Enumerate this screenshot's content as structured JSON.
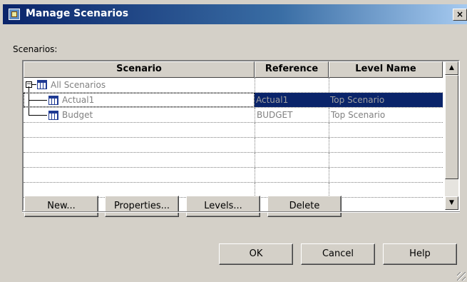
{
  "window": {
    "title": "Manage Scenarios",
    "close_label": "×"
  },
  "scenarios_label": "Scenarios:",
  "grid": {
    "columns": [
      "Scenario",
      "Reference",
      "Level Name"
    ],
    "rows": [
      {
        "name": "All Scenarios",
        "reference": "",
        "level": ""
      },
      {
        "name": "Actual1",
        "reference": "Actual1",
        "level": "Top Scenario"
      },
      {
        "name": "Budget",
        "reference": "BUDGET",
        "level": "Top Scenario"
      }
    ],
    "expander_symbol": "−"
  },
  "scroll": {
    "up": "▲",
    "down": "▼"
  },
  "buttons": {
    "new": "New...",
    "properties": "Properties...",
    "levels": "Levels...",
    "delete": "Delete",
    "ok": "OK",
    "cancel": "Cancel",
    "help": "Help"
  },
  "colors": {
    "selection": "#0a246a",
    "titlebar_start": "#0a246a",
    "titlebar_end": "#a6caf0"
  }
}
